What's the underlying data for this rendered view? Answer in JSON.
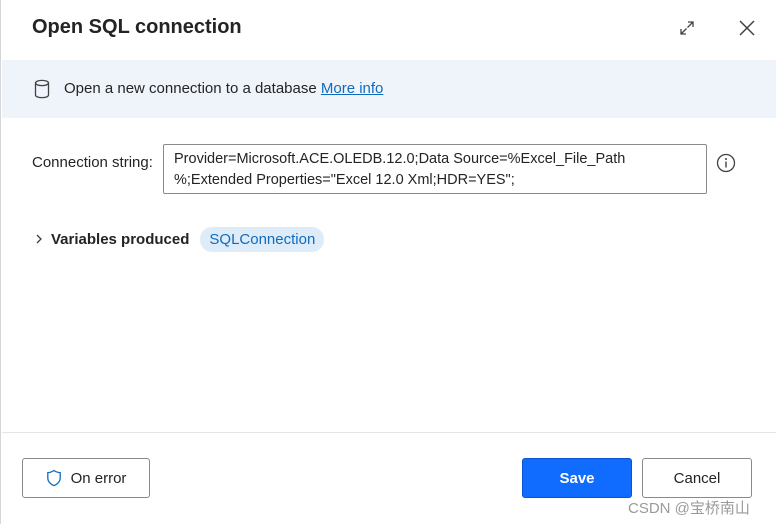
{
  "dialog": {
    "title": "Open SQL connection"
  },
  "icons": {
    "expand": "expand-icon",
    "close": "close-icon",
    "database": "database-icon",
    "help": "info-circle-icon",
    "chevron": "chevron-right-icon",
    "shield": "shield-icon"
  },
  "info": {
    "text": "Open a new connection to a database",
    "link": "More info"
  },
  "connection": {
    "label": "Connection string:",
    "line1": "Provider=Microsoft.ACE.OLEDB.12.0;Data Source=%Excel_File_Path",
    "line2": "%;Extended Properties=\"Excel 12.0 Xml;HDR=YES\";"
  },
  "variables": {
    "label": "Variables produced",
    "items": [
      "SQLConnection"
    ]
  },
  "footer": {
    "on_error": "On error",
    "save": "Save",
    "cancel": "Cancel"
  },
  "watermark": "CSDN @宝桥南山",
  "colors": {
    "accent": "#0f6cff",
    "link": "#0f6cbd",
    "banner_bg": "#eff4fb",
    "chip_bg": "#deecf9"
  }
}
